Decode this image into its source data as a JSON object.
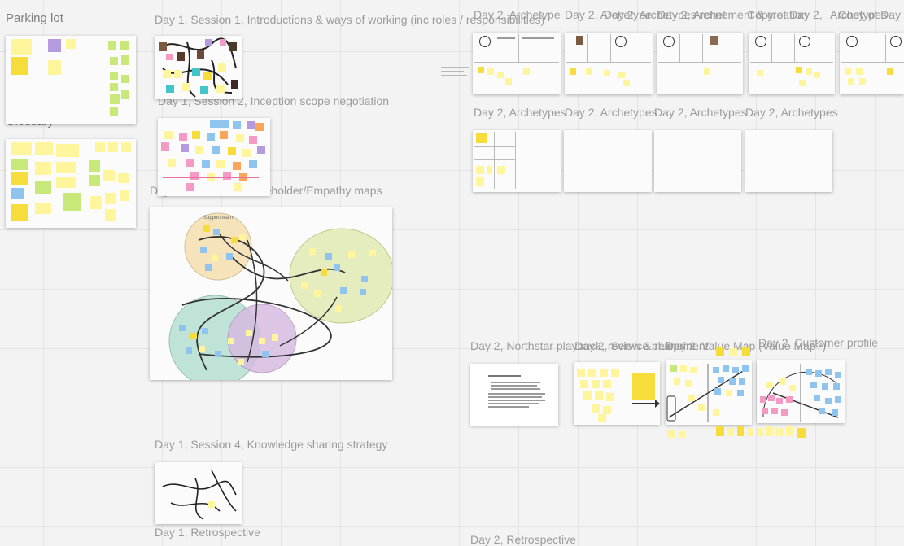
{
  "canvas": {
    "labels": {
      "parking_lot": "Parking lot",
      "glossary": "Glossary",
      "d1s1": "Day 1, Session 1, Introductions & ways of working (inc roles / responsibilities)",
      "d1s2": "Day 1, Session 2, Inception scope negotiation",
      "d1s3": "Day 1, Session 3, Stakeholder/Empathy maps",
      "d1s4": "Day 1, Session 4, Knowledge sharing strategy",
      "d1retro": "Day 1, Retrospective",
      "d2_top1": "Day 2, Archetype",
      "d2_top2": "Day 2, Archetype",
      "d2_top3": "Day 2, Archetypes refinement & creation",
      "d2_top4": "Day 2, Archet",
      "d2_top5": "Copy of Day 2,",
      "d2_top6": "Archetypes",
      "d2_top7": "Copy of Day 2,",
      "d2_mid1": "Day 2, Archetypes",
      "d2_mid2": "Day 2, Archetypes",
      "d2_mid3": "Day 2, Archetypes",
      "d2_mid4": "Day 2, Archetypes",
      "d2_northstar": "Day 2, Northstar playback, review & refinement",
      "d2_service": "Day 2, Service blueprint",
      "d2_value": "Day 2, Value Map (Value Map?)",
      "d2_customer": "Day 2, Customer profile",
      "d2retro": "Day 2, Retrospective"
    },
    "circles": {
      "support_team": "Support team",
      "other1": "",
      "other2": "",
      "other3": ""
    },
    "colors": {
      "canvas": "#f3f3f3",
      "label": "#9b9b9b",
      "sticky_yellow": "#f7dd3c",
      "sticky_light_yellow": "#fff59c",
      "sticky_green": "#c8e97a",
      "sticky_blue": "#8fc4ee",
      "sticky_pink": "#f39bc4",
      "sticky_purple": "#b49bdf",
      "sticky_orange": "#f9a55a",
      "circle_orange": "#f6dfae",
      "circle_green": "#e3ecb8",
      "circle_teal": "#b6dfd2",
      "circle_purple": "#d6b9e0"
    }
  }
}
